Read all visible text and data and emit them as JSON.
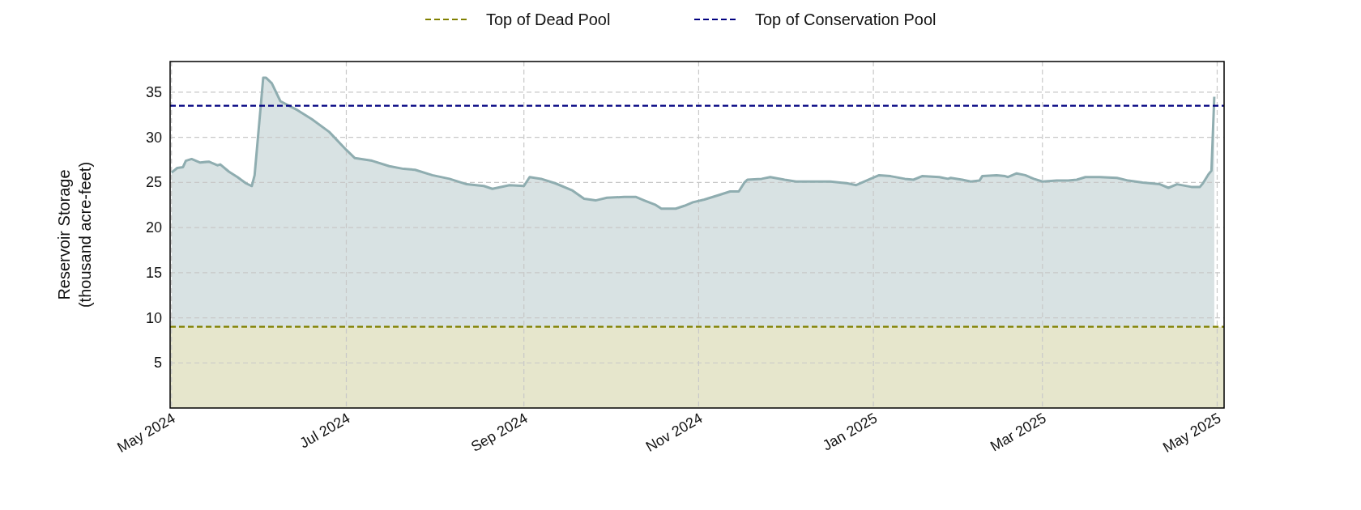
{
  "chart": {
    "chart_data": {
      "type": "area",
      "ylabel": "Reservoir Storage\n(thousand acre-feet)",
      "x": [
        "2024-05-01",
        "2024-05-03",
        "2024-05-05",
        "2024-05-06",
        "2024-05-08",
        "2024-05-11",
        "2024-05-14",
        "2024-05-17",
        "2024-05-18",
        "2024-05-21",
        "2024-05-24",
        "2024-05-27",
        "2024-05-29",
        "2024-05-30",
        "2024-06-01",
        "2024-06-02",
        "2024-06-03",
        "2024-06-05",
        "2024-06-08",
        "2024-06-11",
        "2024-06-14",
        "2024-06-19",
        "2024-06-25",
        "2024-07-01",
        "2024-07-04",
        "2024-07-10",
        "2024-07-16",
        "2024-07-21",
        "2024-07-25",
        "2024-07-31",
        "2024-08-06",
        "2024-08-12",
        "2024-08-18",
        "2024-08-21",
        "2024-08-27",
        "2024-09-01",
        "2024-09-03",
        "2024-09-07",
        "2024-09-12",
        "2024-09-18",
        "2024-09-22",
        "2024-09-26",
        "2024-09-30",
        "2024-10-06",
        "2024-10-10",
        "2024-10-13",
        "2024-10-17",
        "2024-10-19",
        "2024-10-24",
        "2024-10-27",
        "2024-10-30",
        "2024-11-03",
        "2024-11-08",
        "2024-11-12",
        "2024-11-15",
        "2024-11-17",
        "2024-11-18",
        "2024-11-23",
        "2024-11-26",
        "2024-12-01",
        "2024-12-05",
        "2024-12-11",
        "2024-12-17",
        "2024-12-23",
        "2024-12-26",
        "2024-12-31",
        "2025-01-03",
        "2025-01-07",
        "2025-01-12",
        "2025-01-15",
        "2025-01-18",
        "2025-01-24",
        "2025-01-27",
        "2025-01-28",
        "2025-02-01",
        "2025-02-04",
        "2025-02-07",
        "2025-02-08",
        "2025-02-13",
        "2025-02-16",
        "2025-02-17",
        "2025-02-20",
        "2025-02-23",
        "2025-02-26",
        "2025-03-01",
        "2025-03-06",
        "2025-03-10",
        "2025-03-13",
        "2025-03-16",
        "2025-03-21",
        "2025-03-27",
        "2025-03-31",
        "2025-04-05",
        "2025-04-11",
        "2025-04-14",
        "2025-04-17",
        "2025-04-22",
        "2025-04-25",
        "2025-04-26",
        "2025-04-28",
        "2025-04-29",
        "2025-04-30"
      ],
      "series": [
        {
          "color": "#8fadb0",
          "values": [
            26.1,
            26.6,
            26.7,
            27.4,
            27.6,
            27.2,
            27.3,
            26.9,
            27.0,
            26.2,
            25.6,
            24.9,
            24.6,
            25.8,
            33,
            36.6,
            36.6,
            36.0,
            34,
            33.5,
            33.0,
            32.0,
            30.6,
            28.6,
            27.7,
            27.4,
            26.8,
            26.5,
            26.4,
            25.8,
            25.4,
            24.8,
            24.6,
            24.3,
            24.7,
            24.6,
            25.6,
            25.4,
            24.9,
            24.1,
            23.2,
            23.0,
            23.3,
            23.4,
            23.4,
            23.0,
            22.5,
            22.1,
            22.1,
            22.4,
            22.8,
            23.1,
            23.6,
            24.0,
            24.0,
            25.0,
            25.3,
            25.4,
            25.6,
            25.3,
            25.1,
            25.1,
            25.1,
            24.9,
            24.7,
            25.4,
            25.8,
            25.7,
            25.4,
            25.3,
            25.7,
            25.6,
            25.4,
            25.5,
            25.3,
            25.1,
            25.2,
            25.7,
            25.8,
            25.7,
            25.6,
            26.0,
            25.8,
            25.4,
            25.1,
            25.2,
            25.2,
            25.3,
            25.6,
            25.6,
            25.5,
            25.2,
            25.0,
            24.8,
            24.4,
            24.8,
            24.5,
            24.5,
            24.9,
            25.9,
            26.3,
            34.5
          ]
        }
      ],
      "ref_lines": [
        {
          "axis": "y",
          "value": 9,
          "label": "Top of Dead Pool",
          "color": "#808000"
        },
        {
          "axis": "y",
          "value": 33.5,
          "label": "Top of Conservation Pool",
          "color": "#000080"
        }
      ],
      "grid": true,
      "legend": "top",
      "xlim": [
        "2024-04-30T12:00:00Z",
        "2025-05-03T10:00:00Z"
      ],
      "ylim": [
        0,
        38.4
      ],
      "xticks": [
        {
          "value": "2024-05-01",
          "label": "May 2024"
        },
        {
          "value": "2024-07-01",
          "label": "Jul 2024"
        },
        {
          "value": "2024-09-01",
          "label": "Sep 2024"
        },
        {
          "value": "2024-11-01",
          "label": "Nov 2024"
        },
        {
          "value": "2025-01-01",
          "label": "Jan 2025"
        },
        {
          "value": "2025-03-01",
          "label": "Mar 2025"
        },
        {
          "value": "2025-05-01",
          "label": "May 2025"
        }
      ],
      "yticks": [
        5,
        10,
        15,
        20,
        25,
        30,
        35
      ]
    }
  }
}
